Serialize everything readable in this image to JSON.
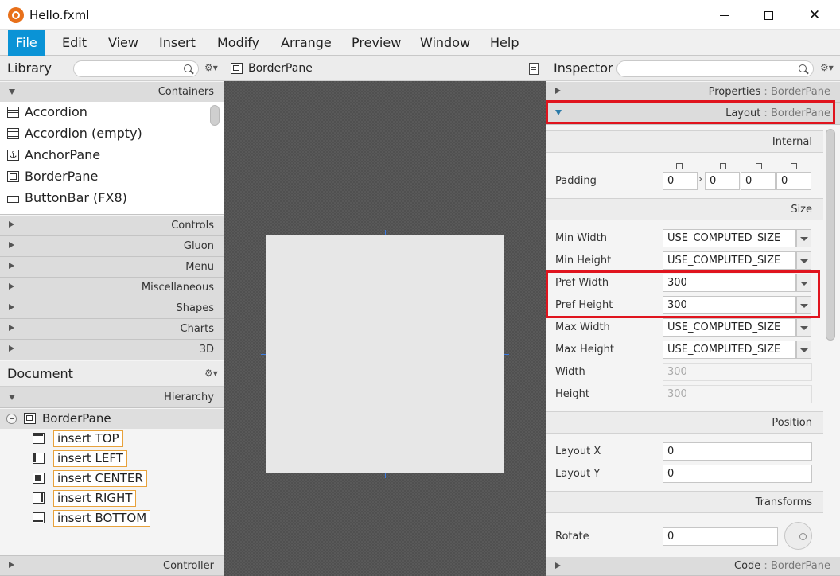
{
  "window": {
    "title": "Hello.fxml"
  },
  "menu": [
    "File",
    "Edit",
    "View",
    "Insert",
    "Modify",
    "Arrange",
    "Preview",
    "Window",
    "Help"
  ],
  "library": {
    "title": "Library",
    "section_open": "Containers",
    "items": [
      "Accordion",
      "Accordion  (empty)",
      "AnchorPane",
      "BorderPane",
      "ButtonBar  (FX8)"
    ],
    "sections": [
      "Controls",
      "Gluon",
      "Menu",
      "Miscellaneous",
      "Shapes",
      "Charts",
      "3D"
    ]
  },
  "document": {
    "title": "Document",
    "section": "Hierarchy",
    "root": "BorderPane",
    "children": [
      "insert TOP",
      "insert LEFT",
      "insert CENTER",
      "insert RIGHT",
      "insert BOTTOM"
    ],
    "controller": "Controller"
  },
  "content": {
    "title": "BorderPane"
  },
  "inspector": {
    "title": "Inspector",
    "properties": {
      "label": "Properties",
      "sep": " : ",
      "target": "BorderPane"
    },
    "layout": {
      "label": "Layout",
      "sep": " : ",
      "target": "BorderPane"
    },
    "code": {
      "label": "Code",
      "sep": " : ",
      "target": "BorderPane"
    },
    "groups": {
      "internal": "Internal",
      "size": "Size",
      "position": "Position",
      "transforms": "Transforms"
    },
    "padding": {
      "label": "Padding",
      "values": [
        "0",
        "0",
        "0",
        "0"
      ]
    },
    "size_rows": [
      {
        "label": "Min Width",
        "value": "USE_COMPUTED_SIZE"
      },
      {
        "label": "Min Height",
        "value": "USE_COMPUTED_SIZE"
      },
      {
        "label": "Pref Width",
        "value": "300"
      },
      {
        "label": "Pref Height",
        "value": "300"
      },
      {
        "label": "Max Width",
        "value": "USE_COMPUTED_SIZE"
      },
      {
        "label": "Max Height",
        "value": "USE_COMPUTED_SIZE"
      }
    ],
    "width": {
      "label": "Width",
      "value": "300"
    },
    "height": {
      "label": "Height",
      "value": "300"
    },
    "layout_x": {
      "label": "Layout X",
      "value": "0"
    },
    "layout_y": {
      "label": "Layout Y",
      "value": "0"
    },
    "rotate": {
      "label": "Rotate",
      "value": "0"
    }
  },
  "colors": {
    "menu_active": "#0a93d6",
    "highlight": "#e0141e",
    "insert_border": "#e8a23b",
    "app_icon": "#e8701a"
  }
}
